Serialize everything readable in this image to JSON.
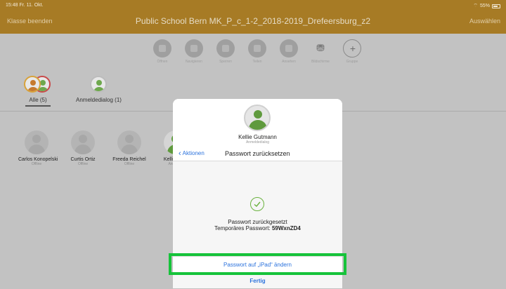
{
  "status": {
    "time": "15:48  Fr. 11. Okt.",
    "battery": "55%",
    "wifi": "wifi"
  },
  "header": {
    "left_action": "Klasse beenden",
    "title": "Public School Bern MK_P_c_1-2_2018-2019_Drefeersburg_z2",
    "right_action": "Auswählen"
  },
  "toolbar": {
    "items": [
      {
        "label": "Öffnen",
        "icon": "app-icon"
      },
      {
        "label": "Navigieren",
        "icon": "compass-icon"
      },
      {
        "label": "Sperren",
        "icon": "lock-icon"
      },
      {
        "label": "Teilen",
        "icon": "screen-icon"
      },
      {
        "label": "Ansehen",
        "icon": "eye-icon"
      },
      {
        "label": "Bildschirme",
        "icon": "binoculars-icon"
      },
      {
        "label": "Gruppe",
        "icon": "plus-icon"
      }
    ]
  },
  "filters": {
    "all": "Alle (5)",
    "login": "Anmeldedialog (1)"
  },
  "students": [
    {
      "name": "Carlos Konopelski",
      "status": "Offline"
    },
    {
      "name": "Curtis Ortiz",
      "status": "Offline"
    },
    {
      "name": "Freeda Reichel",
      "status": "Offline"
    },
    {
      "name": "Kellie Gu...",
      "status": "Anmeld..."
    }
  ],
  "modal": {
    "name": "Kellie Gutmann",
    "subtitle": "Anmeldedialog",
    "back": "Aktionen",
    "title": "Passwort zurücksetzen",
    "message": "Passwort zurückgesetzt",
    "temp_label": "Temporäres Passwort: ",
    "temp_value": "59WxnZD4",
    "change_button": "Passwort auf „iPad“ ändern",
    "done_button": "Fertig"
  },
  "colors": {
    "header": "#a77b25",
    "accent": "#2b72dd",
    "highlight": "#16c33a",
    "success": "#6ab23e"
  }
}
